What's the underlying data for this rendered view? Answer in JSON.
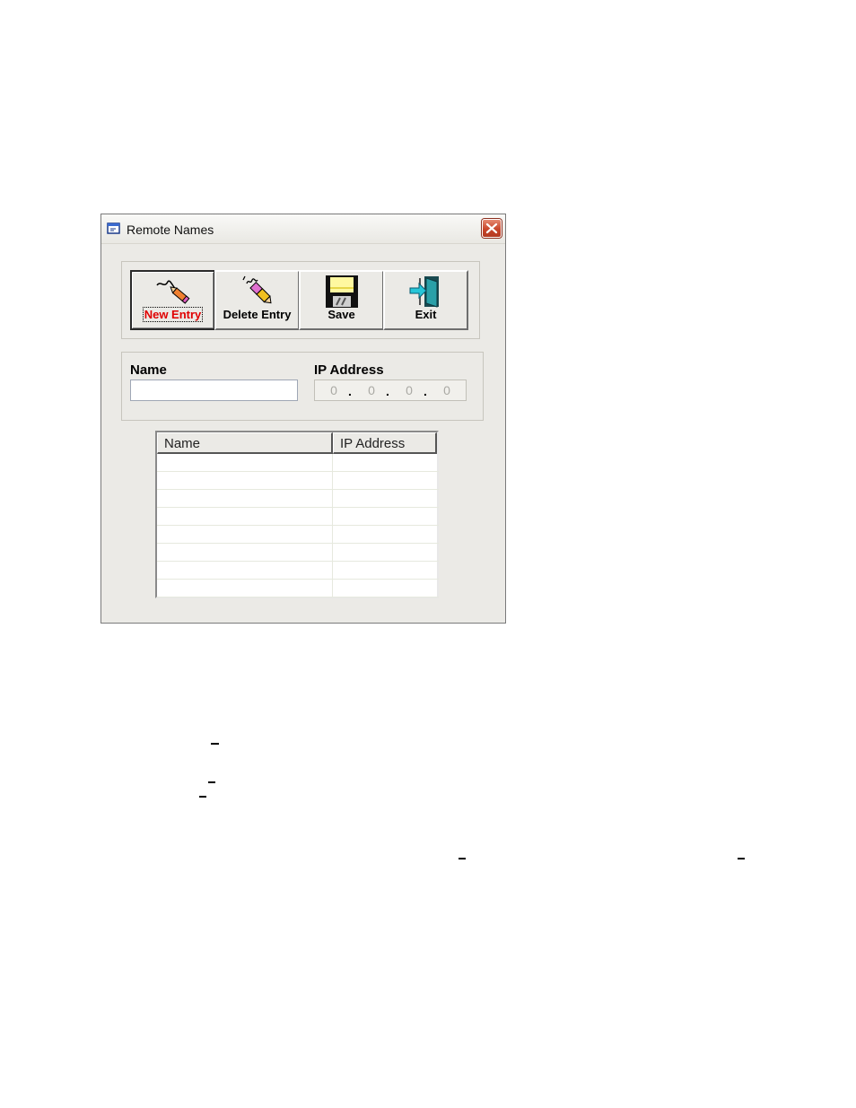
{
  "window": {
    "title": "Remote  Names"
  },
  "toolbar": {
    "buttons": [
      {
        "id": "new_entry",
        "label": "New Entry",
        "icon": "pencil-draw-icon",
        "default": true
      },
      {
        "id": "delete_entry",
        "label": "Delete Entry",
        "icon": "pencil-eraser-icon"
      },
      {
        "id": "save",
        "label": "Save",
        "icon": "floppy-disk-icon"
      },
      {
        "id": "exit",
        "label": "Exit",
        "icon": "exit-door-icon"
      }
    ]
  },
  "form": {
    "name_label": "Name",
    "name_value": "",
    "ip_label": "IP Address",
    "ip_octets": [
      "0",
      "0",
      "0",
      "0"
    ]
  },
  "list": {
    "columns": [
      "Name",
      "IP Address"
    ],
    "rows": [
      [
        "",
        ""
      ],
      [
        "",
        ""
      ],
      [
        "",
        ""
      ],
      [
        "",
        ""
      ],
      [
        "",
        ""
      ],
      [
        "",
        ""
      ],
      [
        "",
        ""
      ],
      [
        "",
        ""
      ]
    ]
  },
  "colors": {
    "window_bg": "#ebeae6",
    "default_button_text": "#e00000",
    "close_button": "#c8452a"
  }
}
